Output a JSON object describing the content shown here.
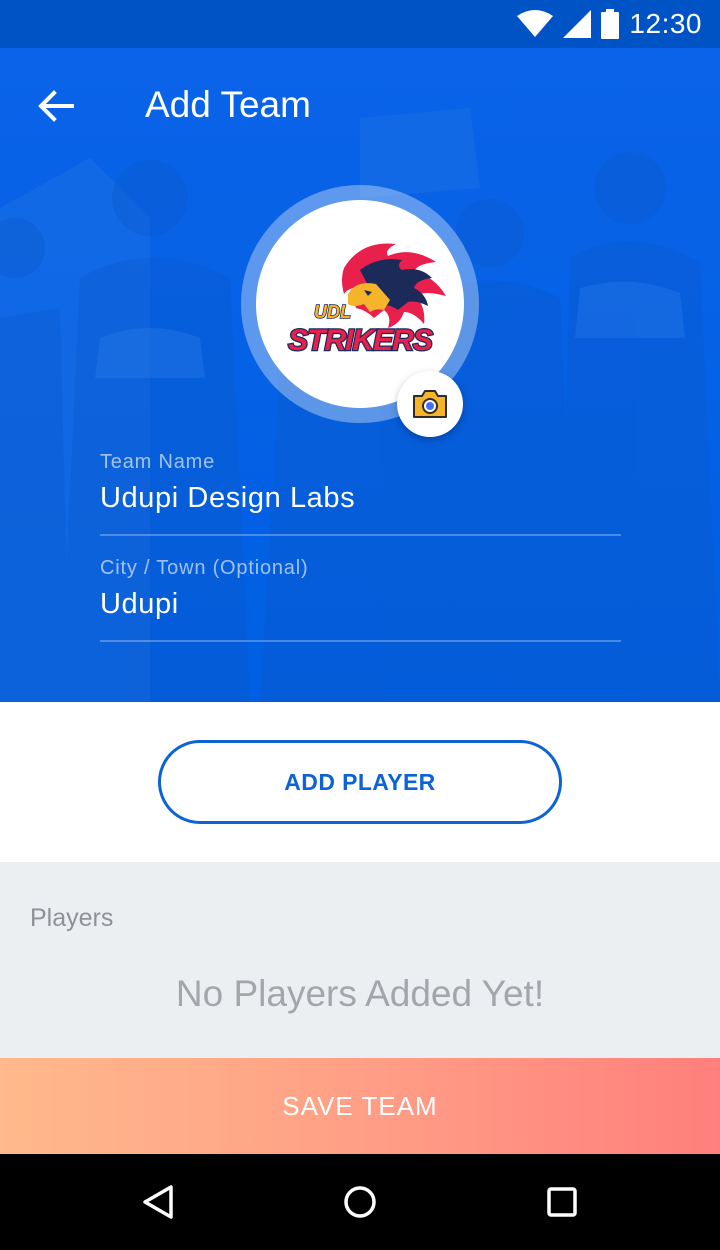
{
  "status_bar": {
    "time": "12:30"
  },
  "header": {
    "title": "Add Team"
  },
  "team_logo": {
    "top_text": "UDL",
    "main_text": "STRIKERS"
  },
  "form": {
    "team_name": {
      "label": "Team Name",
      "value": "Udupi Design Labs"
    },
    "city": {
      "label": "City / Town (Optional)",
      "value": "Udupi"
    }
  },
  "actions": {
    "add_player_label": "ADD PLAYER",
    "save_label": "SAVE TEAM"
  },
  "players": {
    "heading": "Players",
    "empty_message": "No Players Added Yet!"
  },
  "colors": {
    "primary": "#0061e6",
    "accent_button": "#0b63d6",
    "save_gradient_start": "#ffb98b",
    "save_gradient_end": "#ff7f7c"
  },
  "icons": [
    "wifi-icon",
    "signal-icon",
    "battery-icon",
    "back-arrow-icon",
    "camera-icon",
    "nav-back-icon",
    "nav-home-icon",
    "nav-recents-icon"
  ]
}
